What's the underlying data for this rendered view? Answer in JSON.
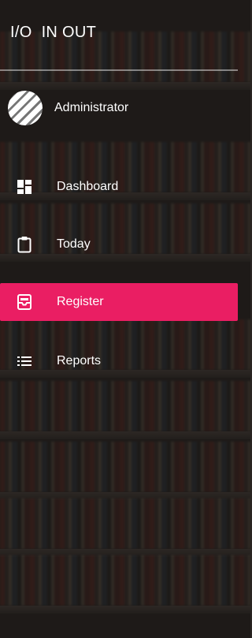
{
  "app": {
    "logo_text": "I/O",
    "title": "IN OUT"
  },
  "user": {
    "name": "Administrator"
  },
  "menu": [
    {
      "label": "Dashboard",
      "icon": "dashboard-icon",
      "active": false
    },
    {
      "label": "Today",
      "icon": "clipboard-icon",
      "active": false
    },
    {
      "label": "Register",
      "icon": "inbox-icon",
      "active": true
    },
    {
      "label": "Reports",
      "icon": "list-icon",
      "active": false
    }
  ],
  "colors": {
    "accent": "#ea1e63"
  }
}
